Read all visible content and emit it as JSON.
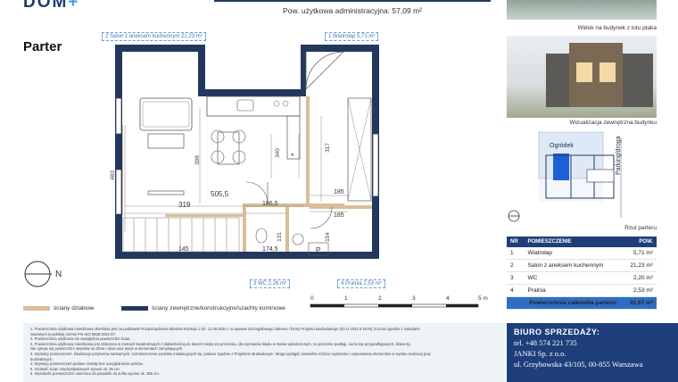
{
  "header": {
    "logo_text": "DOM",
    "logo_mark": "+",
    "usable_area": "Pow. użytkowa administracyjna: 57,09 m²"
  },
  "plan": {
    "floor_title": "Parter",
    "room_labels": {
      "salon": "2 Salon z aneksem kuchennym 21,23 m²",
      "wiatrolap": "1 Wiatrołap 5,71 m²",
      "wc": "3 WC 2,26 m²",
      "pralnia": "4 Pralnia 2,53 m²"
    },
    "dimensions": {
      "d483": "483",
      "d398": "398",
      "d340": "340",
      "d317": "317",
      "d505_5": "505,5",
      "d319": "319",
      "d186_5": "186,5",
      "d185a": "185",
      "d185b": "185",
      "d174_5": "174,5",
      "d131": "131",
      "d154": "154",
      "d145": "145"
    },
    "marks": {
      "p_mark": "P",
      "asterisk": "*"
    }
  },
  "legend": {
    "partition_walls": "ściany działowe",
    "external_walls": "ściany zewnętrzne/konstrukcyjne/szachty kominowe",
    "partition_color": "#d9bd98",
    "external_color": "#23385f"
  },
  "scale": {
    "ticks": [
      "0",
      "1",
      "2",
      "3",
      "4",
      "5 m"
    ]
  },
  "notes": [
    "1. Powierzchnia użytkowa mieszkania określona jest na podstawie Rozporządzenia Ministra Rozwoju z dn. 11.09.2020 r. w sprawie szczegółowego zakresu i formy Projektu Budowlanego (Dz.U.2022.0.1679), liczona zgodnie z zasadami",
    "zawartymi w polskiej normie PN-ISO 9836:2022-07.",
    "2. Powierzchnia użytkowa nie uwzględnia powierzchni ścian,",
    "2. Powierzchnia użytkowa mieszkania jest obliczona w metrach kwadratowych z dokładnością do dwóch miejsc po przecinku, dla wymiarów lokalu w stanie wykończonym, na poziomie podłogi, nie licząc przypodłogowych, listew itp.",
    "Nie ujmuje się powierzchni otworów ne drzwi i okna oraz wnęk w elementach zamykających.",
    "3. Wymiary pomieszczeń, lokalizacje przyborów sanitarnych, rozmieszczenie punktów instalacyjnych itp. podano zgodnie z Projektem Budowlanym. Mogą wystąpić niewielkie różnice wymiarów i usytuowania elementów w wyniku realizacji prac",
    "budowlanych.",
    "4. Wymiary pomieszczeń podane zostały bez uwzględnienia tynków.",
    "5. Grubość ścian międzylokalowych wynosi ok. 25 cm.",
    "6. Wysokość pomieszczeń mierzona od posadzki do sufitu wynosi ok. 265 cm."
  ],
  "sidebar": {
    "view_birds_eye": "Widok na budynek z lotu ptaka",
    "view_external": "Wizualizacja zewnętrzna budynku",
    "site_garden": "Ogródek",
    "site_parking": "Parking/droga",
    "floor_plan_caption": "Rzut parteru"
  },
  "room_table": {
    "headers": [
      "NR",
      "POMIESZCZENIE",
      "POW."
    ],
    "rows": [
      {
        "nr": "1",
        "name": "Wiatrołap",
        "area": "5,71 m²"
      },
      {
        "nr": "2",
        "name": "Salon z aneksem kuchennym",
        "area": "21,23 m²"
      },
      {
        "nr": "3",
        "name": "WC",
        "area": "2,20 m²"
      },
      {
        "nr": "4",
        "name": "Pralnia",
        "area": "2,53 m²"
      }
    ],
    "total_label": "Powierzchnia całkowita parteru:",
    "total_value": "31,67 m²"
  },
  "sales": {
    "title": "BIURO SPRZEDAŻY:",
    "phone": "tel. +48 574 221 735",
    "company": "JANKI Sp. z o.o.",
    "address": "ul. Grzybowska 43/105, 00-855 Warszawa"
  }
}
